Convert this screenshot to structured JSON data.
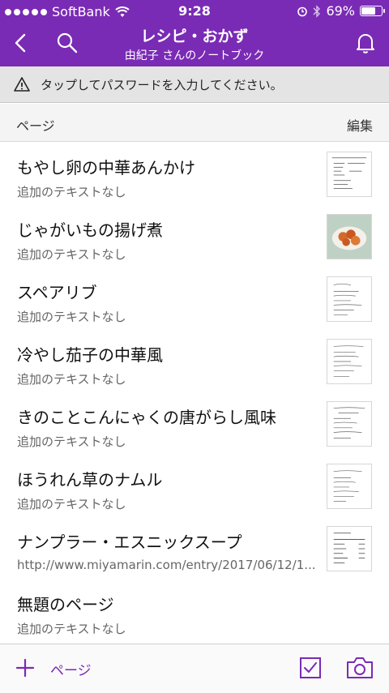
{
  "status": {
    "carrier": "SoftBank",
    "time": "9:28",
    "battery": "69%",
    "battery_level": 0.69
  },
  "nav": {
    "title": "レシピ・おかず",
    "subtitle": "由紀子 さんのノートブック"
  },
  "banner": {
    "text": "タップしてパスワードを入力してください。"
  },
  "section": {
    "label": "ページ",
    "edit": "編集"
  },
  "pages": [
    {
      "title": "もやし卵の中華あんかけ",
      "sub": "追加のテキストなし"
    },
    {
      "title": "じゃがいもの揚げ煮",
      "sub": "追加のテキストなし"
    },
    {
      "title": "スペアリブ",
      "sub": "追加のテキストなし"
    },
    {
      "title": "冷やし茄子の中華風",
      "sub": "追加のテキストなし"
    },
    {
      "title": "きのことこんにゃくの唐がらし風味",
      "sub": "追加のテキストなし"
    },
    {
      "title": "ほうれん草のナムル",
      "sub": "追加のテキストなし"
    },
    {
      "title": "ナンプラー・エスニックスープ",
      "sub": "http://www.miyamarin.com/entry/2017/06/12/1..."
    },
    {
      "title": "無題のページ",
      "sub": "追加のテキストなし"
    }
  ],
  "toolbar": {
    "add_label": "ページ"
  },
  "colors": {
    "accent": "#7a2bb5"
  }
}
